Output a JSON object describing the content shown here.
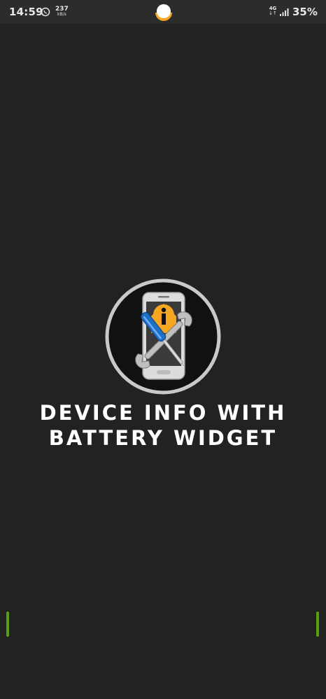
{
  "status_bar": {
    "time": "14:59",
    "net_speed_value": "237",
    "net_speed_unit": "kB/s",
    "network_type": "4G",
    "network_arrows": "↓↑",
    "battery": "35%",
    "icons": [
      "whatsapp-icon",
      "camera-dot-icon",
      "signal-icon"
    ]
  },
  "splash": {
    "title_line1": "DEVICE INFO WITH",
    "title_line2": "BATTERY WIDGET",
    "logo": "device-info-logo-icon"
  },
  "colors": {
    "background": "#222222",
    "status_bar": "#2c2c2c",
    "edge_accent": "#5a9e12",
    "logo_orange": "#f5a623",
    "logo_ring": "#c9c9c9"
  }
}
